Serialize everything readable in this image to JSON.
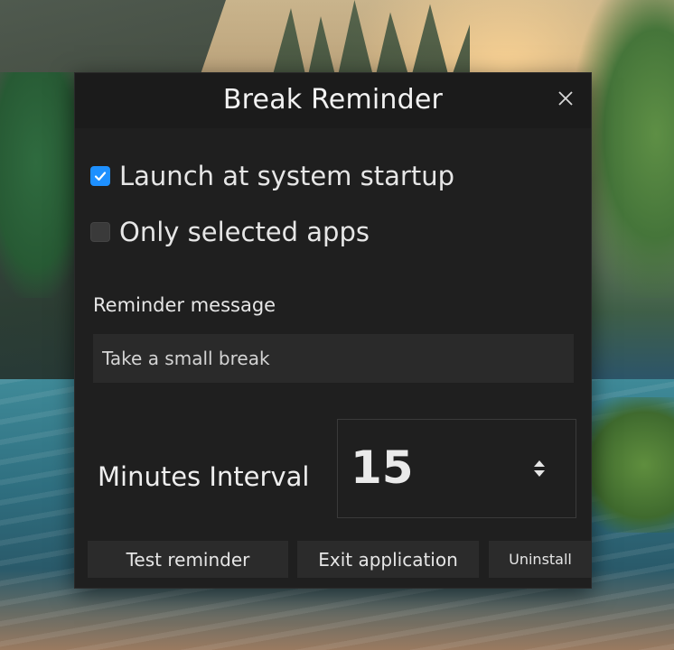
{
  "window": {
    "title": "Break Reminder"
  },
  "settings": {
    "launch_at_startup": {
      "label": "Launch at system startup",
      "checked": true
    },
    "only_selected_apps": {
      "label": "Only selected apps",
      "checked": false
    }
  },
  "reminder": {
    "label": "Reminder message",
    "value": "Take a small break"
  },
  "interval": {
    "label": "Minutes Interval",
    "value": "15"
  },
  "buttons": {
    "test": "Test reminder",
    "exit": "Exit application",
    "uninstall": "Uninstall"
  },
  "colors": {
    "accent": "#1e90ff",
    "dialog_bg": "#1f1f1f",
    "control_bg": "#2b2b2b"
  },
  "icons": {
    "close": "close-icon",
    "check": "checkmark-icon",
    "stepper": "up-down-arrows-icon"
  }
}
